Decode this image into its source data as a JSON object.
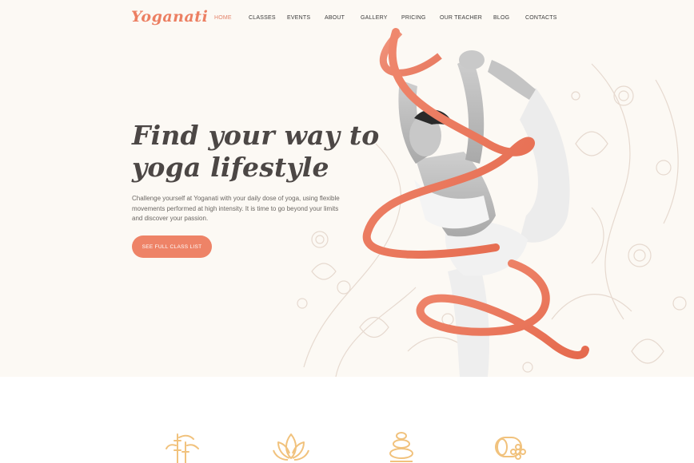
{
  "brand": {
    "logo_text": "Yoganati",
    "accent_color": "#ee8367"
  },
  "nav": {
    "items": [
      {
        "label": "HOME",
        "active": true
      },
      {
        "label": "CLASSES",
        "active": false
      },
      {
        "label": "EVENTS",
        "active": false
      },
      {
        "label": "ABOUT",
        "active": false
      },
      {
        "label": "GALLERY",
        "active": false
      },
      {
        "label": "PRICING",
        "active": false
      },
      {
        "label": "OUR TEACHER",
        "active": false
      },
      {
        "label": "BLOG",
        "active": false
      },
      {
        "label": "CONTACTS",
        "active": false
      }
    ]
  },
  "hero": {
    "title_line1": "Find your way to",
    "title_line2": "yoga lifestyle",
    "intro": "Challenge yourself at Yoganati with your daily dose of yoga, using flexible movements performed at high intensity. It is time to go beyond your limits and discover your passion.",
    "cta_label": "SEE FULL CLASS LIST",
    "image": "yoga-woman-dancer-pose-with-ribbon"
  },
  "features": {
    "icons": [
      "bamboo-icon",
      "lotus-icon",
      "stacked-stones-icon",
      "yoga-mat-flower-icon"
    ],
    "icon_color": "#f1c27d"
  }
}
